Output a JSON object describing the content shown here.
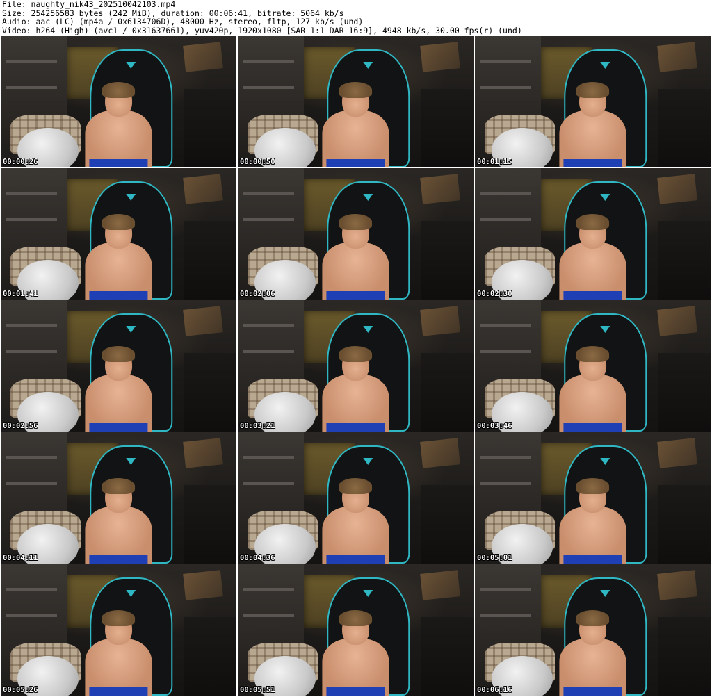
{
  "header": {
    "file_line": "File: naughty_nik43_202510042103.mp4",
    "size_line": "Size: 254256583 bytes (242 MiB), duration: 00:06:41, bitrate: 5064 kb/s",
    "audio_line": "Audio: aac (LC) (mp4a / 0x6134706D), 48000 Hz, stereo, fltp, 127 kb/s (und)",
    "video_line": "Video: h264 (High) (avc1 / 0x31637661), yuv420p, 1920x1080 [SAR 1:1 DAR 16:9], 4948 kb/s, 30.00 fps(r) (und)"
  },
  "thumbnails": [
    {
      "timestamp": "00:00:26"
    },
    {
      "timestamp": "00:00:50"
    },
    {
      "timestamp": "00:01:15"
    },
    {
      "timestamp": "00:01:41"
    },
    {
      "timestamp": "00:02:06"
    },
    {
      "timestamp": "00:02:30"
    },
    {
      "timestamp": "00:02:56"
    },
    {
      "timestamp": "00:03:21"
    },
    {
      "timestamp": "00:03:46"
    },
    {
      "timestamp": "00:04:11"
    },
    {
      "timestamp": "00:04:36"
    },
    {
      "timestamp": "00:05:01"
    },
    {
      "timestamp": "00:05:26"
    },
    {
      "timestamp": "00:05:51"
    },
    {
      "timestamp": "00:06:16"
    }
  ],
  "colors": {
    "chair_accent": "#2fb8c4",
    "shorts": "#1f3fb4",
    "timestamp_text": "#ffffff"
  }
}
